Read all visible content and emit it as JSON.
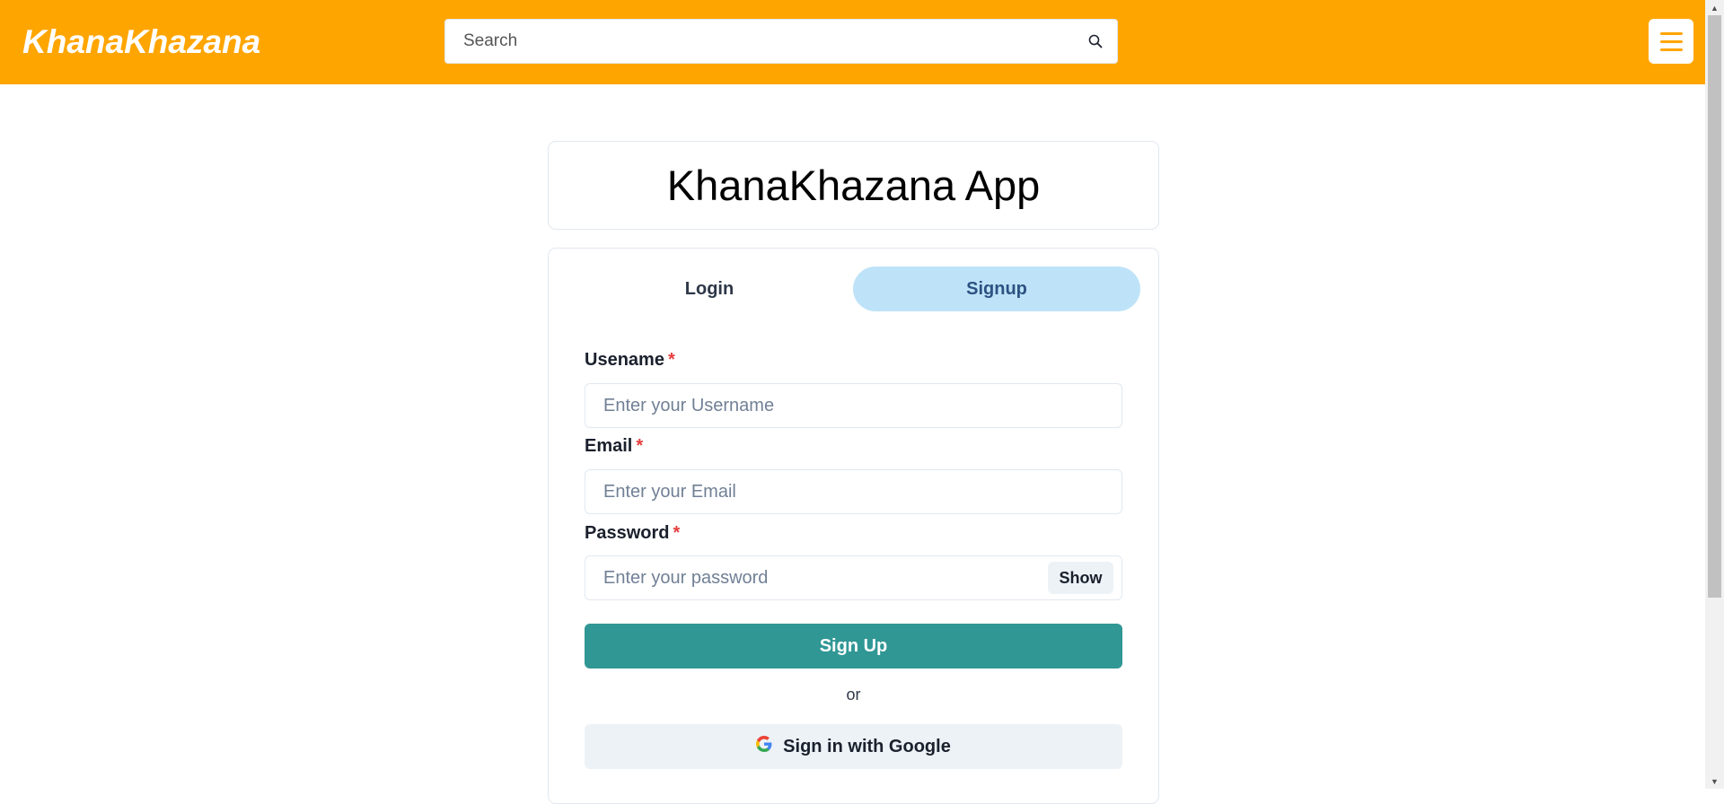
{
  "header": {
    "brand": "KhanaKhazana",
    "search_placeholder": "Search",
    "search_icon": "search-icon",
    "menu_icon": "hamburger-menu-icon",
    "background_color": "#FFA500"
  },
  "title_card": {
    "title": "KhanaKhazana App"
  },
  "tabs": {
    "login": "Login",
    "signup": "Signup",
    "active": "Signup"
  },
  "form": {
    "username": {
      "label": "Usename",
      "required_mark": "*",
      "placeholder": "Enter your Username",
      "value": ""
    },
    "email": {
      "label": "Email",
      "required_mark": "*",
      "placeholder": "Enter your Email",
      "value": ""
    },
    "password": {
      "label": "Password",
      "required_mark": "*",
      "placeholder": "Enter your password",
      "value": "",
      "show_label": "Show"
    },
    "submit_label": "Sign Up",
    "or_text": "or",
    "google_label": "Sign in with Google",
    "google_icon": "google-icon",
    "submit_color": "#319795",
    "active_tab_color": "#BEE3F8"
  }
}
